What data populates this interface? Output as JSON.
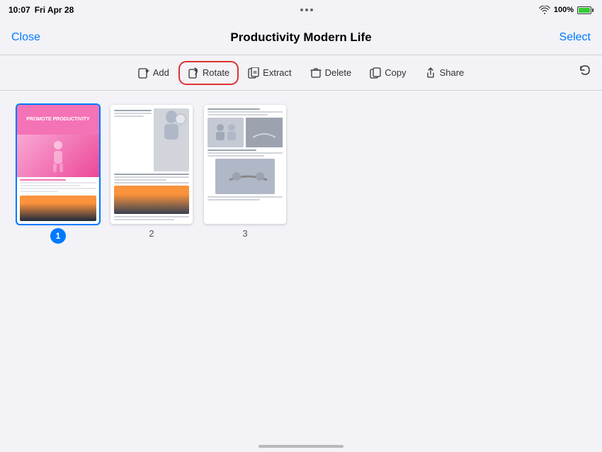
{
  "statusBar": {
    "time": "10:07",
    "day": "Fri Apr 28",
    "wifi": "WiFi",
    "battery": "100%",
    "batteryIcon": "battery-full"
  },
  "header": {
    "closeLabel": "Close",
    "title": "Productivity Modern Life",
    "selectLabel": "Select"
  },
  "toolbar": {
    "addLabel": "Add",
    "rotateLabel": "Rotate",
    "extractLabel": "Extract",
    "deleteLabel": "Delete",
    "copyLabel": "Copy",
    "shareLabel": "Share",
    "activeButton": "rotate"
  },
  "pages": [
    {
      "num": "1",
      "selected": true,
      "badge": true
    },
    {
      "num": "2",
      "selected": false,
      "badge": false
    },
    {
      "num": "3",
      "selected": false,
      "badge": false
    }
  ],
  "page1": {
    "headerText": "Promote Productivity"
  }
}
